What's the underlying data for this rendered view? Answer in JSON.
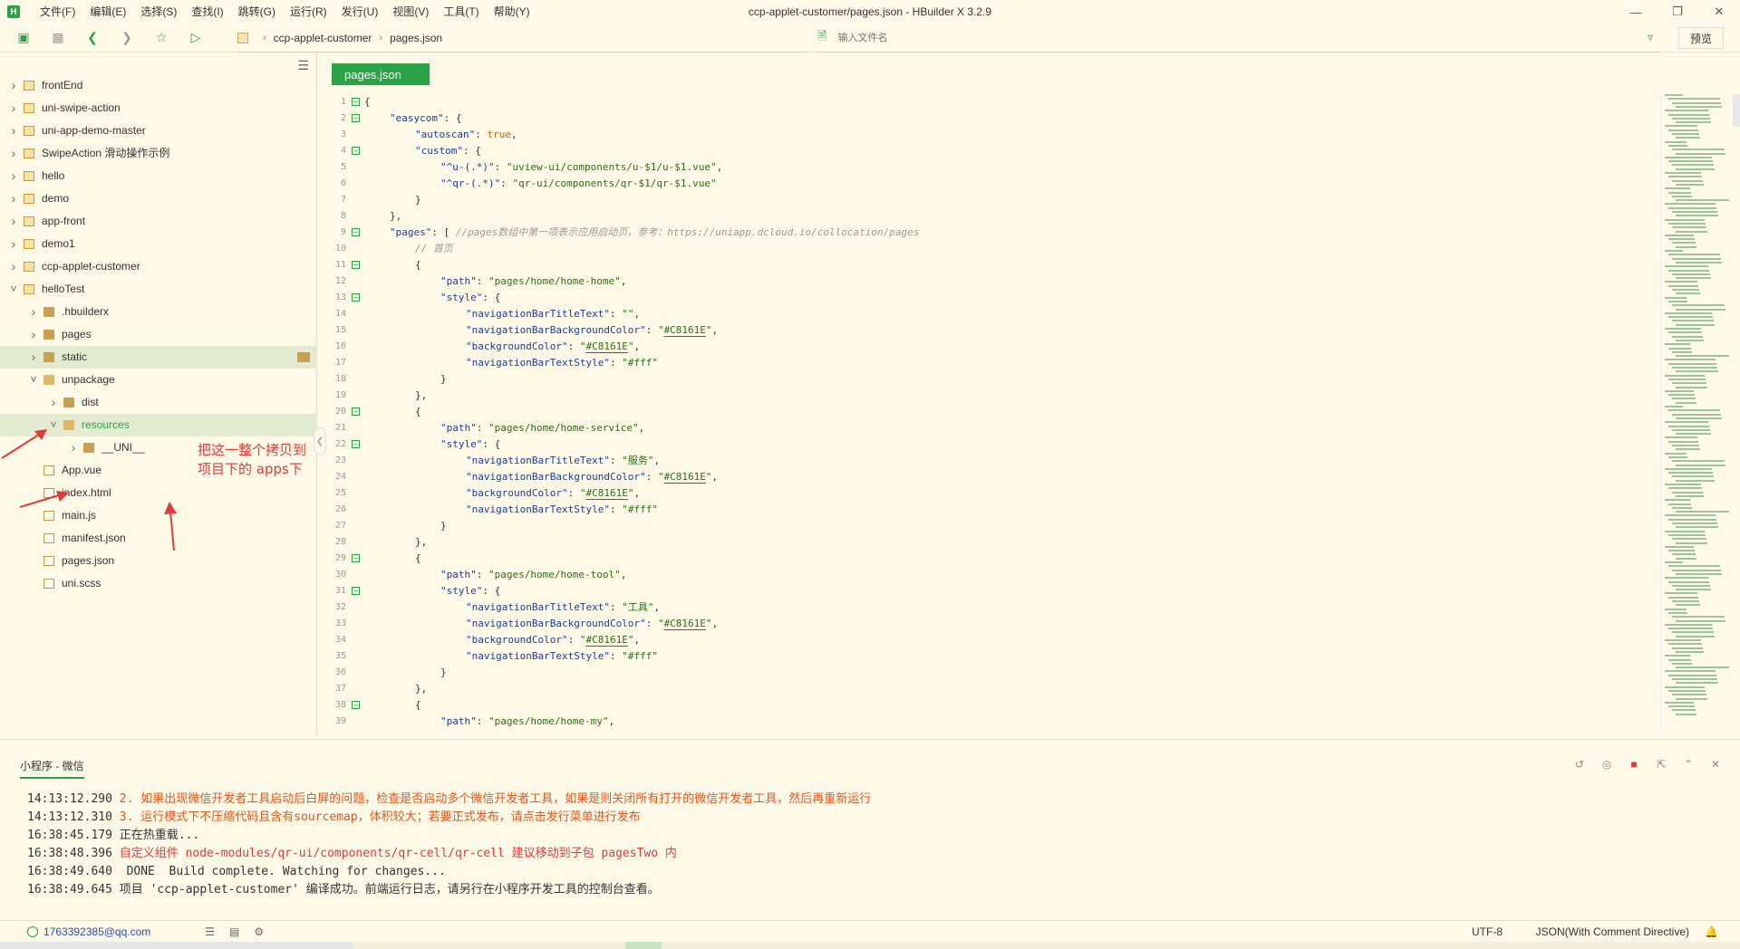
{
  "app": {
    "logo": "H",
    "title": "ccp-applet-customer/pages.json - HBuilder X 3.2.9"
  },
  "menu": [
    "文件(F)",
    "编辑(E)",
    "选择(S)",
    "查找(I)",
    "跳转(G)",
    "运行(R)",
    "发行(U)",
    "视图(V)",
    "工具(T)",
    "帮助(Y)"
  ],
  "toolbar": {
    "breadcrumb": [
      "ccp-applet-customer",
      "pages.json"
    ],
    "file_search_placeholder": "输入文件名",
    "preview_label": "预览"
  },
  "sidebar": {
    "tree": [
      {
        "label": "frontEnd",
        "level": 0,
        "icon": "project-icon",
        "state": "closed"
      },
      {
        "label": "uni-swipe-action",
        "level": 0,
        "icon": "project-icon",
        "state": "closed"
      },
      {
        "label": "uni-app-demo-master",
        "level": 0,
        "icon": "project-icon",
        "state": "closed"
      },
      {
        "label": "SwipeAction 滑动操作示例",
        "level": 0,
        "icon": "project-icon",
        "state": "closed"
      },
      {
        "label": "hello",
        "level": 0,
        "icon": "project-icon",
        "state": "closed"
      },
      {
        "label": "demo",
        "level": 0,
        "icon": "project-icon",
        "state": "closed"
      },
      {
        "label": "app-front",
        "level": 0,
        "icon": "project-icon",
        "state": "closed"
      },
      {
        "label": "demo1",
        "level": 0,
        "icon": "project-icon",
        "state": "closed"
      },
      {
        "label": "ccp-applet-customer",
        "level": 0,
        "icon": "project-icon",
        "state": "closed"
      },
      {
        "label": "helloTest",
        "level": 0,
        "icon": "project-icon",
        "state": "open"
      },
      {
        "label": ".hbuilderx",
        "level": 1,
        "icon": "folder-icon",
        "state": "closed"
      },
      {
        "label": "pages",
        "level": 1,
        "icon": "folder-icon",
        "state": "closed"
      },
      {
        "label": "static",
        "level": 1,
        "icon": "folder-icon",
        "state": "closed",
        "highlight": true
      },
      {
        "label": "unpackage",
        "level": 1,
        "icon": "folder-open-icon",
        "state": "open"
      },
      {
        "label": "dist",
        "level": 2,
        "icon": "folder-icon",
        "state": "closed"
      },
      {
        "label": "resources",
        "level": 2,
        "icon": "folder-open-icon",
        "state": "open",
        "highlight": true,
        "green": true
      },
      {
        "label": "__UNI__",
        "level": 3,
        "icon": "folder-icon",
        "state": "closed"
      },
      {
        "label": "App.vue",
        "level": 1,
        "icon": "vue-file-icon",
        "state": "none"
      },
      {
        "label": "index.html",
        "level": 1,
        "icon": "html-file-icon",
        "state": "none"
      },
      {
        "label": "main.js",
        "level": 1,
        "icon": "js-file-icon",
        "state": "none"
      },
      {
        "label": "manifest.json",
        "level": 1,
        "icon": "json-file-icon",
        "state": "none"
      },
      {
        "label": "pages.json",
        "level": 1,
        "icon": "json-file-icon",
        "state": "none"
      },
      {
        "label": "uni.scss",
        "level": 1,
        "icon": "scss-file-icon",
        "state": "none"
      }
    ],
    "annotation": "把这一整个拷贝到项目下的 apps下"
  },
  "editor": {
    "tab_label": "pages.json",
    "lines": [
      {
        "n": "1",
        "fold": "-",
        "indent": 0,
        "html": "{"
      },
      {
        "n": "2",
        "fold": "-",
        "indent": 1,
        "html": "<span class='k'>\"easycom\"</span>: {"
      },
      {
        "n": "3",
        "fold": "",
        "indent": 2,
        "html": "<span class='k'>\"autoscan\"</span>: <span class='b'>true</span>,"
      },
      {
        "n": "4",
        "fold": "-",
        "indent": 2,
        "html": "<span class='k'>\"custom\"</span>: {"
      },
      {
        "n": "5",
        "fold": "",
        "indent": 3,
        "html": "<span class='k'>\"^u-(.*)\"</span>: <span class='s'>\"uview-ui/components/u-$1/u-$1.vue\"</span>,"
      },
      {
        "n": "6",
        "fold": "",
        "indent": 3,
        "html": "<span class='k'>\"^qr-(.*)\"</span>: <span class='s'>\"qr-ui/components/qr-$1/qr-$1.vue\"</span>"
      },
      {
        "n": "7",
        "fold": "",
        "indent": 2,
        "html": "}"
      },
      {
        "n": "8",
        "fold": "",
        "indent": 1,
        "html": "},"
      },
      {
        "n": "9",
        "fold": "-",
        "indent": 1,
        "html": "<span class='k'>\"pages\"</span>: [ <span class='c'>//pages数组中第一项表示应用启动页，参考：https://uniapp.dcloud.io/collocation/pages</span>"
      },
      {
        "n": "10",
        "fold": "",
        "indent": 2,
        "html": "<span class='c'>// 首页</span>"
      },
      {
        "n": "11",
        "fold": "-",
        "indent": 2,
        "html": "{"
      },
      {
        "n": "12",
        "fold": "",
        "indent": 3,
        "html": "<span class='k'>\"path\"</span>: <span class='s'>\"pages/home/home-home\"</span>,"
      },
      {
        "n": "13",
        "fold": "-",
        "indent": 3,
        "html": "<span class='k'>\"style\"</span>: {"
      },
      {
        "n": "14",
        "fold": "",
        "indent": 4,
        "html": "<span class='k'>\"navigationBarTitleText\"</span>: <span class='s'>\"\"</span>,"
      },
      {
        "n": "15",
        "fold": "",
        "indent": 4,
        "html": "<span class='k'>\"navigationBarBackgroundColor\"</span>: <span class='s'>\"<span class='colr'>#C8161E</span>\"</span>,"
      },
      {
        "n": "16",
        "fold": "",
        "indent": 4,
        "html": "<span class='k'>\"backgroundColor\"</span>: <span class='s'>\"<span class='colr'>#C8161E</span>\"</span>,"
      },
      {
        "n": "17",
        "fold": "",
        "indent": 4,
        "html": "<span class='k'>\"navigationBarTextStyle\"</span>: <span class='s'>\"#fff\"</span>"
      },
      {
        "n": "18",
        "fold": "",
        "indent": 3,
        "html": "}"
      },
      {
        "n": "19",
        "fold": "",
        "indent": 2,
        "html": "},"
      },
      {
        "n": "20",
        "fold": "-",
        "indent": 2,
        "html": "{"
      },
      {
        "n": "21",
        "fold": "",
        "indent": 3,
        "html": "<span class='k'>\"path\"</span>: <span class='s'>\"pages/home/home-service\"</span>,"
      },
      {
        "n": "22",
        "fold": "-",
        "indent": 3,
        "html": "<span class='k'>\"style\"</span>: {"
      },
      {
        "n": "23",
        "fold": "",
        "indent": 4,
        "html": "<span class='k'>\"navigationBarTitleText\"</span>: <span class='s'>\"服务\"</span>,"
      },
      {
        "n": "24",
        "fold": "",
        "indent": 4,
        "html": "<span class='k'>\"navigationBarBackgroundColor\"</span>: <span class='s'>\"<span class='colr'>#C8161E</span>\"</span>,"
      },
      {
        "n": "25",
        "fold": "",
        "indent": 4,
        "html": "<span class='k'>\"backgroundColor\"</span>: <span class='s'>\"<span class='colr'>#C8161E</span>\"</span>,"
      },
      {
        "n": "26",
        "fold": "",
        "indent": 4,
        "html": "<span class='k'>\"navigationBarTextStyle\"</span>: <span class='s'>\"#fff\"</span>"
      },
      {
        "n": "27",
        "fold": "",
        "indent": 3,
        "html": "}"
      },
      {
        "n": "28",
        "fold": "",
        "indent": 2,
        "html": "},"
      },
      {
        "n": "29",
        "fold": "-",
        "indent": 2,
        "html": "{"
      },
      {
        "n": "30",
        "fold": "",
        "indent": 3,
        "html": "<span class='k'>\"path\"</span>: <span class='s'>\"pages/home/home-tool\"</span>,"
      },
      {
        "n": "31",
        "fold": "-",
        "indent": 3,
        "html": "<span class='k'>\"style\"</span>: {"
      },
      {
        "n": "32",
        "fold": "",
        "indent": 4,
        "html": "<span class='k'>\"navigationBarTitleText\"</span>: <span class='s'>\"工具\"</span>,"
      },
      {
        "n": "33",
        "fold": "",
        "indent": 4,
        "html": "<span class='k'>\"navigationBarBackgroundColor\"</span>: <span class='s'>\"<span class='colr'>#C8161E</span>\"</span>,"
      },
      {
        "n": "34",
        "fold": "",
        "indent": 4,
        "html": "<span class='k'>\"backgroundColor\"</span>: <span class='s'>\"<span class='colr'>#C8161E</span>\"</span>,"
      },
      {
        "n": "35",
        "fold": "",
        "indent": 4,
        "html": "<span class='k'>\"navigationBarTextStyle\"</span>: <span class='s'>\"#fff\"</span>"
      },
      {
        "n": "36",
        "fold": "",
        "indent": 3,
        "html": "}"
      },
      {
        "n": "37",
        "fold": "",
        "indent": 2,
        "html": "},"
      },
      {
        "n": "38",
        "fold": "-",
        "indent": 2,
        "html": "{"
      },
      {
        "n": "39",
        "fold": "",
        "indent": 3,
        "html": "<span class='k'>\"path\"</span>: <span class='s'>\"pages/home/home-my\"</span>,"
      }
    ]
  },
  "console": {
    "tab_label": "小程序 - 微信",
    "lines": [
      {
        "time": "14:13:12.290",
        "msg": "2. 如果出现微信开发者工具启动后白屏的问题，检查是否启动多个微信开发者工具，如果是则关闭所有打开的微信开发者工具，然后再重新运行",
        "level": "warn"
      },
      {
        "time": "14:13:12.310",
        "msg": "3. 运行模式下不压缩代码且含有sourcemap，体积较大；若要正式发布，请点击发行菜单进行发布",
        "level": "warn"
      },
      {
        "time": "16:38:45.179",
        "msg": "正在热重载...",
        "level": "info"
      },
      {
        "time": "16:38:48.396",
        "msg": "自定义组件 node-modules/qr-ui/components/qr-cell/qr-cell 建议移动到子包 pagesTwo 内",
        "level": "err"
      },
      {
        "time": "16:38:49.640",
        "msg": " DONE  Build complete. Watching for changes...",
        "level": "info"
      },
      {
        "time": "16:38:49.645",
        "msg": "项目 'ccp-applet-customer' 编译成功。前端运行日志，请另行在小程序开发工具的控制台查看。",
        "level": "info"
      }
    ]
  },
  "status": {
    "account": "1763392385@qq.com",
    "encoding": "UTF-8",
    "syntax": "JSON(With Comment Directive)"
  },
  "colors": {
    "accent": "#2ba245",
    "background": "#fffae8",
    "error": "#e23a3a",
    "warn": "#e0571d"
  }
}
